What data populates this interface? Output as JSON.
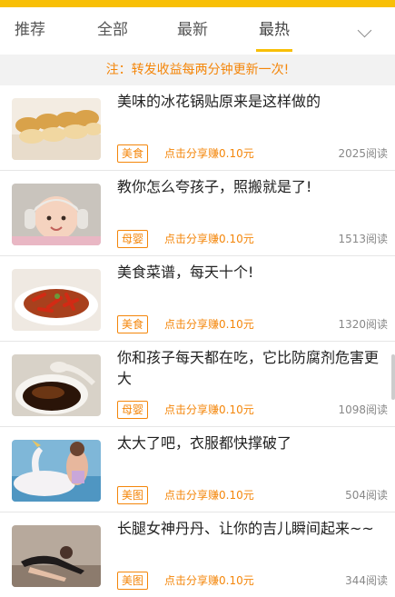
{
  "tabs": [
    {
      "label": "推荐"
    },
    {
      "label": "全部"
    },
    {
      "label": "最新"
    },
    {
      "label": "最热"
    }
  ],
  "active_tab": "最热",
  "notice": "注：转发收益每两分钟更新一次!",
  "articles": [
    {
      "title": "美味的冰花锅贴原来是这样做的",
      "tag": "美食",
      "share": "点击分享赚0.10元",
      "reads": "2025阅读",
      "thumb": "dumplings"
    },
    {
      "title": "教你怎么夸孩子，照搬就是了!",
      "tag": "母婴",
      "share": "点击分享赚0.10元",
      "reads": "1513阅读",
      "thumb": "baby"
    },
    {
      "title": "美食菜谱，每天十个!",
      "tag": "美食",
      "share": "点击分享赚0.10元",
      "reads": "1320阅读",
      "thumb": "chili-dish"
    },
    {
      "title": "你和孩子每天都在吃，它比防腐剂危害更大",
      "tag": "母婴",
      "share": "点击分享赚0.10元",
      "reads": "1098阅读",
      "thumb": "sauce"
    },
    {
      "title": "太大了吧，衣服都快撑破了",
      "tag": "美图",
      "share": "点击分享赚0.10元",
      "reads": "504阅读",
      "thumb": "unicorn-float"
    },
    {
      "title": "长腿女神丹丹、让你的吉儿瞬间起来~~",
      "tag": "美图",
      "share": "点击分享赚0.10元",
      "reads": "344阅读",
      "thumb": "woman-pose"
    }
  ],
  "colors": {
    "accent": "#f8bf06",
    "orange": "#f4860a"
  }
}
